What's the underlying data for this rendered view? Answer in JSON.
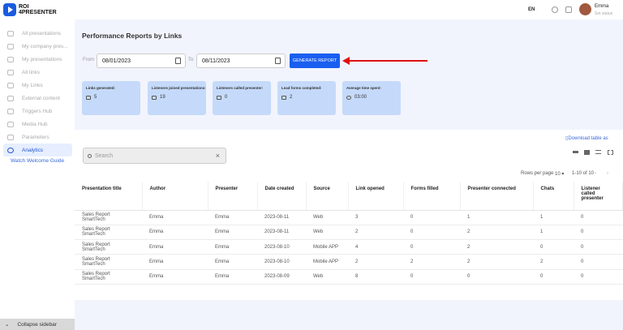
{
  "logo": {
    "line1": "ROI",
    "line2": "4PRESENTER"
  },
  "sidebar": {
    "items": [
      {
        "label": "All presentations"
      },
      {
        "label": "My company pres..."
      },
      {
        "label": "My presentations"
      },
      {
        "label": "All links"
      },
      {
        "label": "My Links"
      },
      {
        "label": "External content"
      },
      {
        "label": "Triggers Hub"
      },
      {
        "label": "Media Hub"
      },
      {
        "label": "Parameters"
      },
      {
        "label": "Analytics"
      }
    ],
    "guide": "Watch Welcome Guide",
    "collapse": "Collapse sidebar"
  },
  "header": {
    "lang": "EN",
    "user": "Emma",
    "status": "Set status"
  },
  "page": {
    "title": "Performance Reports by Links",
    "from_label": "From",
    "from": "08/01/2023",
    "to_label": "To",
    "to": "08/11/2023",
    "generate": "GENERATE REPORT"
  },
  "cards": [
    {
      "title": "Links generated:",
      "value": "5"
    },
    {
      "title": "Listeners joined presentations:",
      "value": "19"
    },
    {
      "title": "Listeners called presenter:",
      "value": "0"
    },
    {
      "title": "Lead forms completed:",
      "value": "2"
    },
    {
      "title": "Average time spent:",
      "value": "03:00"
    }
  ],
  "download": "Download table as",
  "search": {
    "placeholder": "Search"
  },
  "pager": {
    "rows_label": "Rows per page",
    "rows": "10 ▾",
    "range": "1-10 of 10"
  },
  "table": {
    "headers": [
      "Presentation title",
      "Author",
      "Presenter",
      "Date created",
      "Source",
      "Link opened",
      "Forms filled",
      "Presenter connected",
      "Chats",
      "Listener called presenter"
    ],
    "rows": [
      [
        "Sales Report SmartTech",
        "Emma",
        "Emma",
        "2023-08-11",
        "Web",
        "3",
        "0",
        "1",
        "1",
        "0"
      ],
      [
        "Sales Report SmartTech",
        "Emma",
        "Emma",
        "2023-08-11",
        "Web",
        "2",
        "0",
        "2",
        "1",
        "0"
      ],
      [
        "Sales Report SmartTech",
        "Emma",
        "Emma",
        "2023-08-10",
        "Mobile APP",
        "4",
        "0",
        "2",
        "0",
        "0"
      ],
      [
        "Sales Report SmartTech",
        "Emma",
        "Emma",
        "2023-08-10",
        "Mobile APP",
        "2",
        "2",
        "2",
        "2",
        "0"
      ],
      [
        "Sales Report SmartTech",
        "Emma",
        "Emma",
        "2023-08-09",
        "Web",
        "8",
        "0",
        "0",
        "0",
        "0"
      ]
    ]
  }
}
